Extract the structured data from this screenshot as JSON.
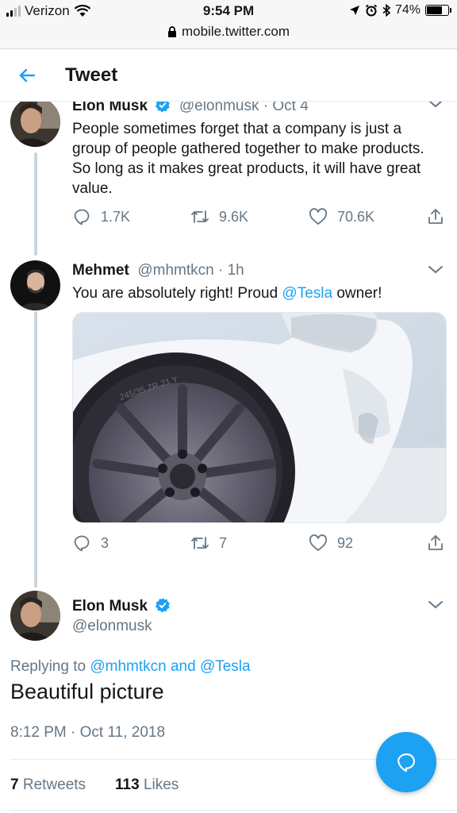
{
  "status_bar": {
    "carrier": "Verizon",
    "time": "9:54 PM",
    "battery": "74%",
    "battery_level": 0.74,
    "url": "mobile.twitter.com"
  },
  "header": {
    "title": "Tweet"
  },
  "thread": [
    {
      "name": "Elon Musk",
      "handle": "@elonmusk",
      "date": "Oct 4",
      "text": "People sometimes forget that a company is just a group of people gathered together to make products. So long as it makes great products, it will have great value.",
      "replies": "1.7K",
      "retweets": "9.6K",
      "likes": "70.6K"
    },
    {
      "name": "Mehmet",
      "handle": "@mhmtkcn",
      "date": "1h",
      "text_before": "You are absolutely right! Proud ",
      "text_mention": "@Tesla",
      "text_after": " owner!",
      "replies": "3",
      "retweets": "7",
      "likes": "92",
      "tire_text": "245/35 ZR 21 Y"
    }
  ],
  "main_tweet": {
    "name": "Elon Musk",
    "handle": "@elonmusk",
    "replying_prefix": "Replying to ",
    "replying_to": "@mhmtkcn and @Tesla",
    "text": "Beautiful picture",
    "timestamp": "8:12 PM · Oct 11, 2018",
    "retweet_count": "7",
    "retweet_label": "Retweets",
    "like_count": "113",
    "like_label": "Likes"
  },
  "icons": {
    "back": "arrow-left-icon",
    "verified": "verified-badge-icon",
    "reply": "reply-icon",
    "retweet": "retweet-icon",
    "like": "heart-icon",
    "share": "share-icon",
    "compose": "compose-reply-icon"
  },
  "colors": {
    "accent": "#1da1f2",
    "muted": "#657786",
    "text": "#14171a",
    "thread_line": "#ccd6dd"
  }
}
